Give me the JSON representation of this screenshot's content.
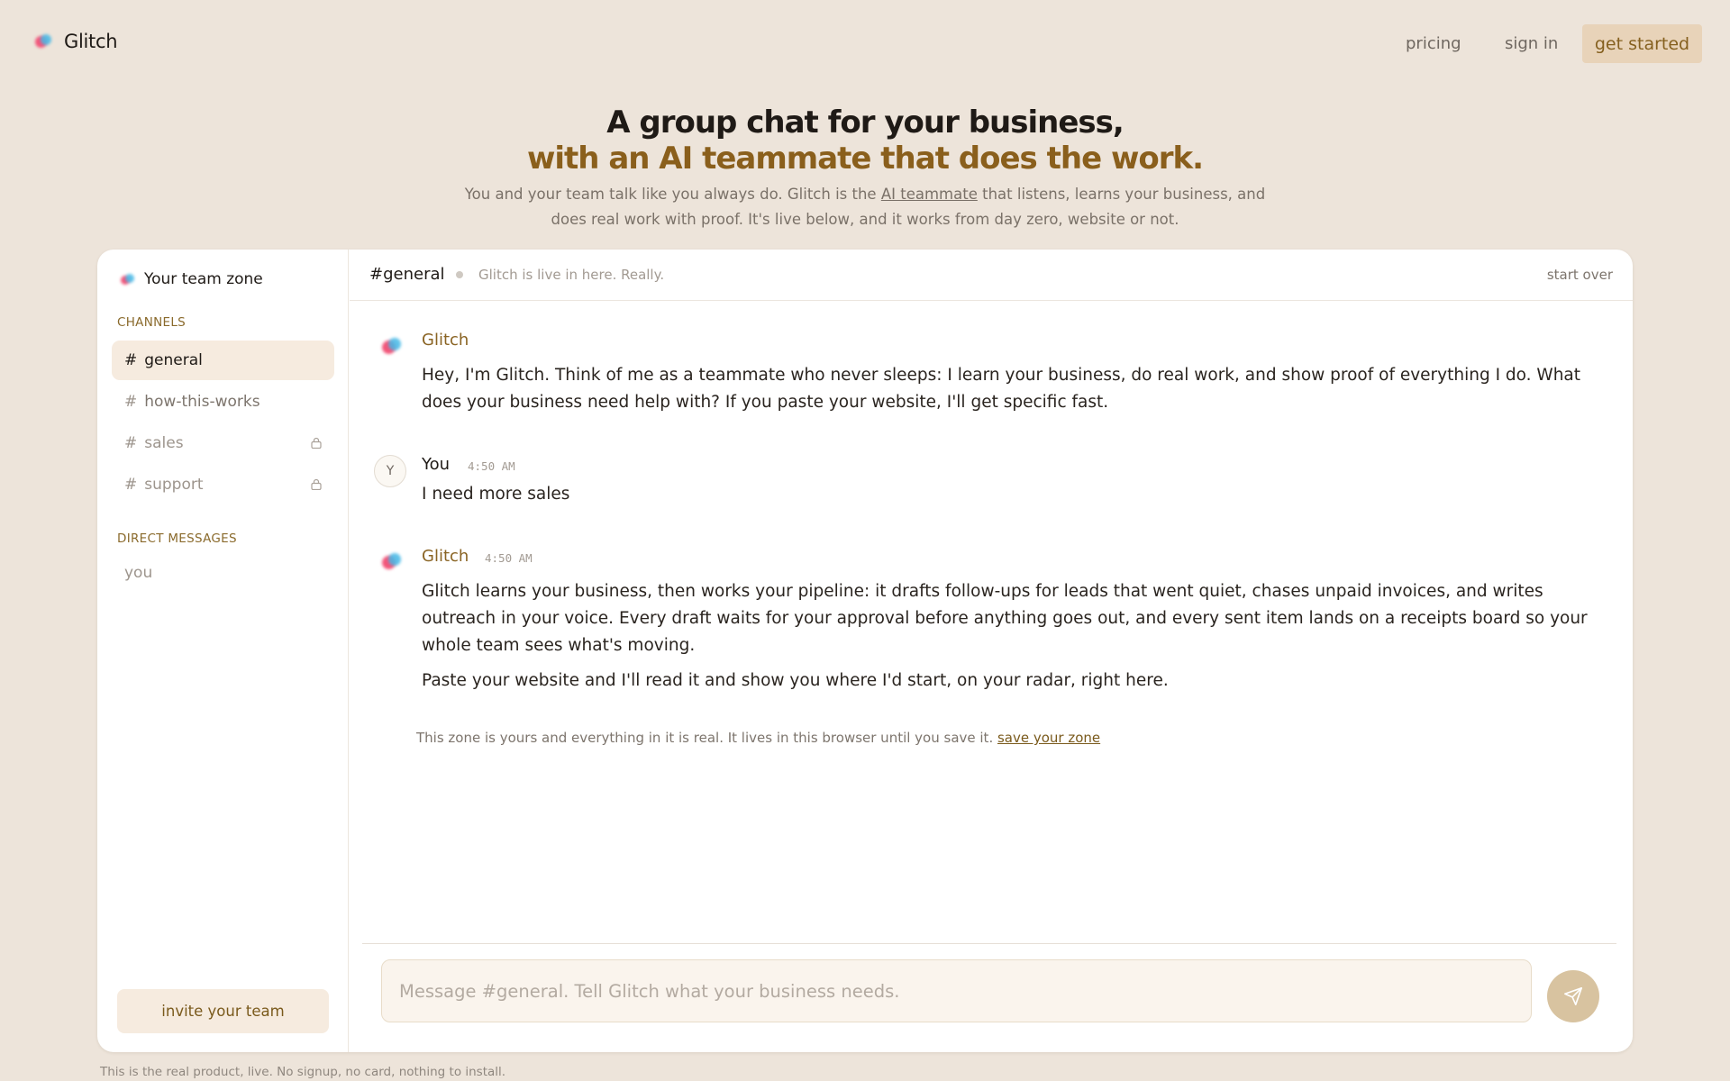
{
  "nav": {
    "brand": "Glitch",
    "links": [
      "pricing",
      "sign in"
    ],
    "cta": "get started"
  },
  "hero": {
    "title_line1": "A group chat for your business,",
    "title_line2": "with an AI teammate that does the work.",
    "sub_before": "You and your team talk like you always do. Glitch is the ",
    "sub_link": "AI teammate",
    "sub_after": " that listens, learns your business, and does real work with proof. It's live below, and it works from day zero, website or not."
  },
  "sidebar": {
    "zone_title": "Your team zone",
    "channels_label": "CHANNELS",
    "channels": [
      {
        "name": "general",
        "locked": false,
        "active": true
      },
      {
        "name": "how-this-works",
        "locked": false,
        "active": false
      },
      {
        "name": "sales",
        "locked": true,
        "active": false
      },
      {
        "name": "support",
        "locked": true,
        "active": false
      }
    ],
    "dm_label": "DIRECT MESSAGES",
    "dm_items": [
      "you"
    ],
    "invite_label": "invite your team"
  },
  "channel": {
    "name": "#general",
    "status": "Glitch is live in here. Really.",
    "start_over": "start over"
  },
  "messages": [
    {
      "sender": "Glitch",
      "time": "",
      "paragraphs": [
        "Hey, I'm Glitch. Think of me as a teammate who never sleeps: I learn your business, do real work, and show proof of everything I do. What does your business need help with? If you paste your website, I'll get specific fast."
      ]
    },
    {
      "sender": "You",
      "avatar_letter": "Y",
      "time": "4:50 AM",
      "paragraphs": [
        "I need more sales"
      ]
    },
    {
      "sender": "Glitch",
      "time": "4:50 AM",
      "paragraphs": [
        "Glitch learns your business, then works your pipeline: it drafts follow-ups for leads that went quiet, chases unpaid invoices, and writes outreach in your voice. Every draft waits for your approval before anything goes out, and every sent item lands on a receipts board so your whole team sees what's moving.",
        "Paste your website and I'll read it and show you where I'd start, on your radar, right here."
      ]
    }
  ],
  "notice": {
    "text": "This zone is yours and everything in it is real. It lives in this browser until you save it. ",
    "link": "save your zone"
  },
  "composer": {
    "placeholder": "Message #general. Tell Glitch what your business needs."
  },
  "footer_note": "This is the real product, live. No signup, no card, nothing to install.",
  "colors": {
    "page_bg": "#ede4da",
    "accent": "#8a5f1c",
    "cta_bg": "#e8d3b9",
    "send_bg": "#d8c3a0"
  },
  "icons": [
    "glitch-logo-icon",
    "lock-icon",
    "send-icon"
  ]
}
